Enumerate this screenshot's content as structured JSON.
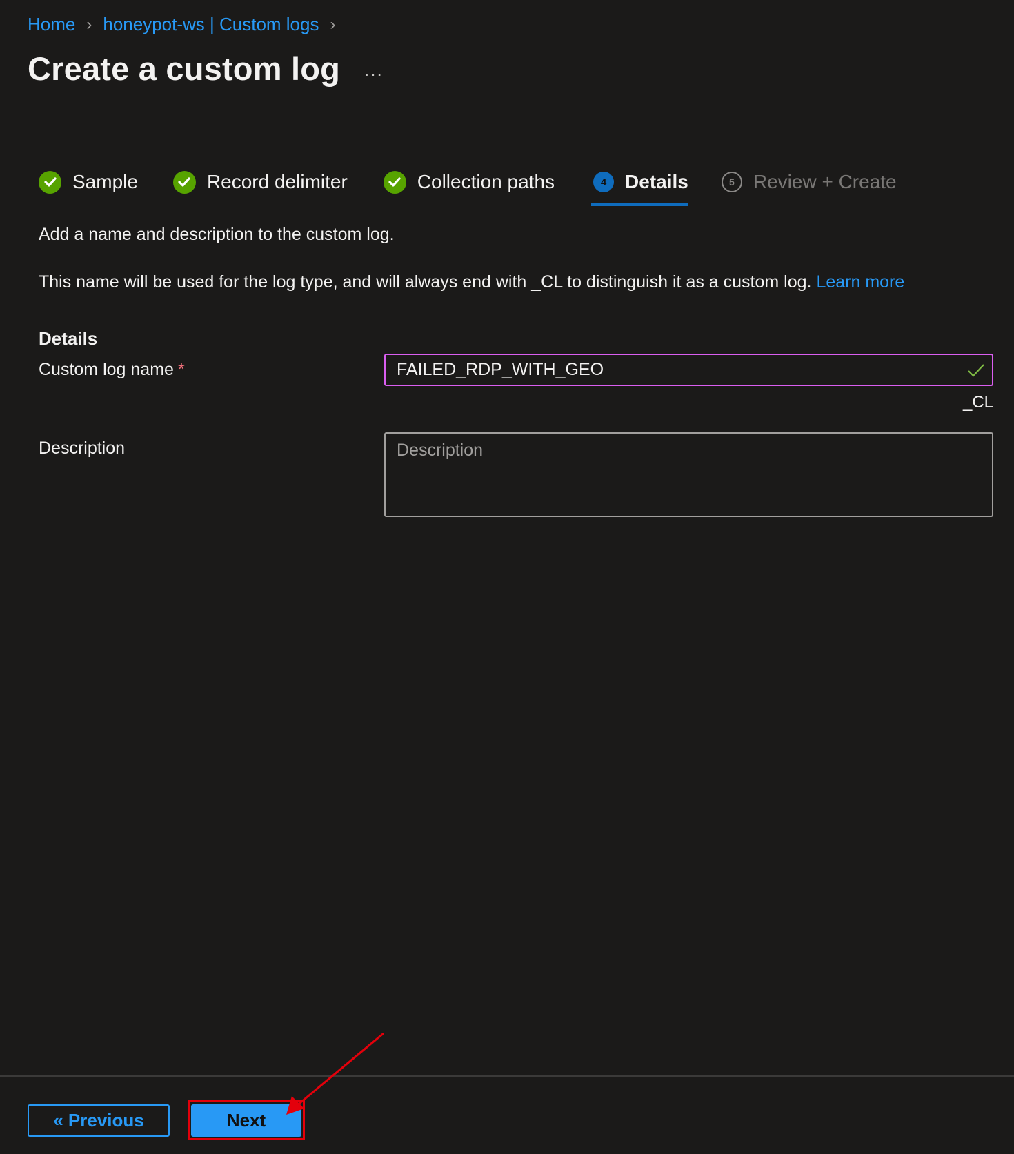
{
  "breadcrumb": {
    "items": [
      {
        "label": "Home"
      },
      {
        "label": "honeypot-ws | Custom logs"
      }
    ]
  },
  "page": {
    "title": "Create a custom log",
    "more_label": "..."
  },
  "wizard": {
    "steps": [
      {
        "number": "1",
        "label": "Sample",
        "state": "done"
      },
      {
        "number": "2",
        "label": "Record delimiter",
        "state": "done"
      },
      {
        "number": "3",
        "label": "Collection paths",
        "state": "done"
      },
      {
        "number": "4",
        "label": "Details",
        "state": "active"
      },
      {
        "number": "5",
        "label": "Review + Create",
        "state": "pending"
      }
    ]
  },
  "content": {
    "intro": "Add a name and description to the custom log.",
    "intro2": "This name will be used for the log type, and will always end with _CL to distinguish it as a custom log.",
    "learn_more": "Learn more",
    "section_heading": "Details",
    "name_label": "Custom log name",
    "required_mark": "*",
    "name_value": "FAILED_RDP_WITH_GEO",
    "name_suffix": "_CL",
    "description_label": "Description",
    "description_placeholder": "Description",
    "description_value": ""
  },
  "footer": {
    "previous_label": "« Previous",
    "next_label": "Next"
  },
  "colors": {
    "accent": "#2899f5",
    "active_step": "#0f6cbd",
    "done_step": "#57a300",
    "valid_input_border": "#da5ef0",
    "annotation": "#e3000b"
  }
}
